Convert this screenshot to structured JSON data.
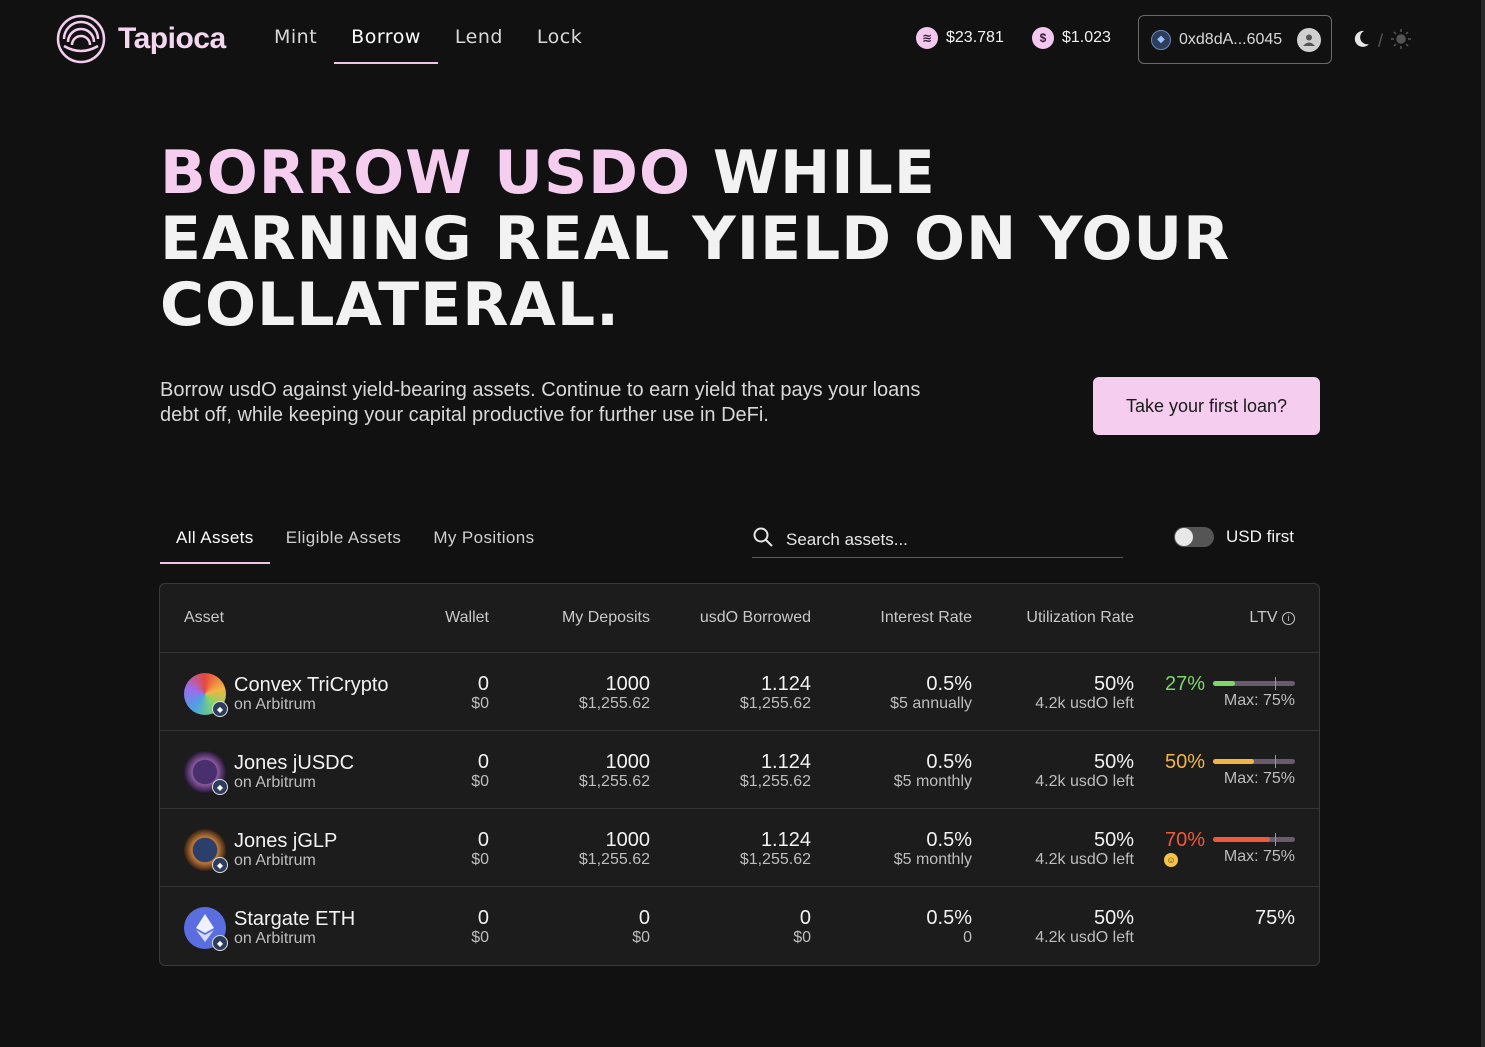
{
  "header": {
    "brand": "Tapioca",
    "nav": [
      "Mint",
      "Borrow",
      "Lend",
      "Lock"
    ],
    "active_nav": "Borrow",
    "prices": [
      {
        "icon": "tapioca-coin-icon",
        "value": "$23.781"
      },
      {
        "icon": "usdo-coin-icon",
        "value": "$1.023"
      }
    ],
    "wallet_address": "0xd8dA...6045",
    "colors": {
      "accent": "#f4cdef",
      "background": "#111111"
    }
  },
  "hero": {
    "title_pink": "BORROW USDO",
    "title_rest": "WHILE EARNING REAL YIELD ON YOUR COLLATERAL.",
    "subtitle": "Borrow usdO against yield-bearing assets. Continue to earn yield that pays your loans debt off, while keeping your capital productive for further use in DeFi.",
    "cta": "Take your first loan?"
  },
  "filters": {
    "tabs": [
      "All Assets",
      "Eligible Assets",
      "My Positions"
    ],
    "active_tab": "All Assets",
    "search_placeholder": "Search assets...",
    "toggle_label": "USD first",
    "toggle_on": false
  },
  "table": {
    "columns": [
      "Asset",
      "Wallet",
      "My Deposits",
      "usdO Borrowed",
      "Interest Rate",
      "Utilization Rate",
      "LTV"
    ],
    "rows": [
      {
        "name": "Convex TriCrypto",
        "chain": "on Arbitrum",
        "wallet": "0",
        "wallet_usd": "$0",
        "deposits": "1000",
        "deposits_usd": "$1,255.62",
        "borrowed": "1.124",
        "borrowed_usd": "$1,255.62",
        "interest": "0.5%",
        "interest_sub": "$5 annually",
        "util": "50%",
        "util_sub": "4.2k usdO left",
        "ltv": "27%",
        "ltv_max": "Max: 75%",
        "ltv_color": "#7fd66b",
        "ltv_fill": 0.27
      },
      {
        "name": "Jones jUSDC",
        "chain": "on Arbitrum",
        "wallet": "0",
        "wallet_usd": "$0",
        "deposits": "1000",
        "deposits_usd": "$1,255.62",
        "borrowed": "1.124",
        "borrowed_usd": "$1,255.62",
        "interest": "0.5%",
        "interest_sub": "$5 monthly",
        "util": "50%",
        "util_sub": "4.2k usdO left",
        "ltv": "50%",
        "ltv_max": "Max: 75%",
        "ltv_color": "#f2b544",
        "ltv_fill": 0.5
      },
      {
        "name": "Jones jGLP",
        "chain": "on Arbitrum",
        "wallet": "0",
        "wallet_usd": "$0",
        "deposits": "1000",
        "deposits_usd": "$1,255.62",
        "borrowed": "1.124",
        "borrowed_usd": "$1,255.62",
        "interest": "0.5%",
        "interest_sub": "$5 monthly",
        "util": "50%",
        "util_sub": "4.2k usdO left",
        "ltv": "70%",
        "ltv_max": "Max: 75%",
        "ltv_color": "#ef5a3c",
        "ltv_fill": 0.7
      },
      {
        "name": "Stargate ETH",
        "chain": "on Arbitrum",
        "wallet": "0",
        "wallet_usd": "$0",
        "deposits": "0",
        "deposits_usd": "$0",
        "borrowed": "0",
        "borrowed_usd": "$0",
        "interest": "0.5%",
        "interest_sub": "0",
        "util": "50%",
        "util_sub": "4.2k usdO left",
        "ltv": "75%"
      }
    ]
  }
}
